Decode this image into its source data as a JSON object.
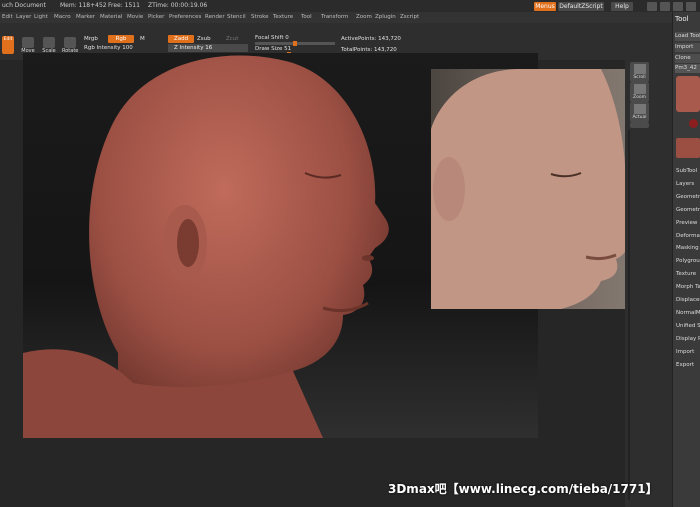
{
  "titlebar": {
    "app": "uch Document",
    "mem": "Mem: 118+452",
    "free": "Free: 1511",
    "ztime": "ZTime: 00:00:19.06",
    "menus_btn": "Menus",
    "script_btn": "DefaultZScript",
    "help_btn": "Help"
  },
  "menubar": [
    "Edit",
    "Layer",
    "Light",
    "Macro",
    "Marker",
    "Material",
    "Movie",
    "Picker",
    "Preferences",
    "Render",
    "Stencil",
    "Stroke",
    "Texture",
    "Tool",
    "Transform",
    "Zoom",
    "Zplugin",
    "Zscript"
  ],
  "toolbar": {
    "edit_label": "Edit",
    "move_label": "Move",
    "scale_label": "Scale",
    "rotate_label": "Rotate",
    "mrgb": "Mrgb",
    "rgb": "Rgb",
    "m": "M",
    "rgb_intensity": "Rgb Intensity 100",
    "zadd": "Zadd",
    "zsub": "Zsub",
    "zcut": "Zcut",
    "z_intensity": "Z Intensity 16",
    "focal_shift": "Focal Shift 0",
    "draw_size": "Draw Size 51",
    "active_points": "ActivePoints: 143,720",
    "total_points": "TotalPoints: 143,720"
  },
  "shelf": [
    "Scroll",
    "Zoom",
    "Actual"
  ],
  "tool_panel": {
    "title": "Tool",
    "load": "Load Tool",
    "import": "Import",
    "clone": "Clone",
    "item": "Pm3_42",
    "subs": [
      "SubTool",
      "Layers",
      "Geometry",
      "Geometry HD",
      "Preview",
      "Deformation",
      "Masking",
      "Polygroups",
      "Texture",
      "Morph Target",
      "Displacement",
      "NormalMap",
      "Unified Skin",
      "Display Properties",
      "Import",
      "Export"
    ]
  },
  "watermark": "3Dmax吧【www.linecg.com/tieba/1771】",
  "colors": {
    "accent": "#e0701c",
    "skin": "#a8584b",
    "bg": "#2e2e2e"
  }
}
